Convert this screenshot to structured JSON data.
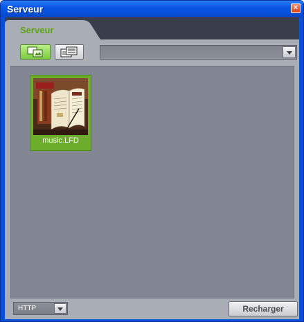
{
  "window": {
    "title": "Serveur",
    "close_glyph": "×"
  },
  "tabs": [
    {
      "label": "Serveur",
      "active": true
    }
  ],
  "toolbar": {
    "thumbnail_view_icon": "thumbnail-view-icon",
    "list_view_icon": "list-view-icon",
    "path_value": ""
  },
  "files": [
    {
      "name": "music.LFD",
      "selected": true,
      "thumbnail_icon": "music-book-thumbnail"
    }
  ],
  "footer": {
    "protocol": "HTTP",
    "reload_label": "Recharger"
  },
  "colors": {
    "accent_green": "#6cad2c",
    "tab_label_green": "#5da317",
    "title_blue": "#0b5be6"
  }
}
